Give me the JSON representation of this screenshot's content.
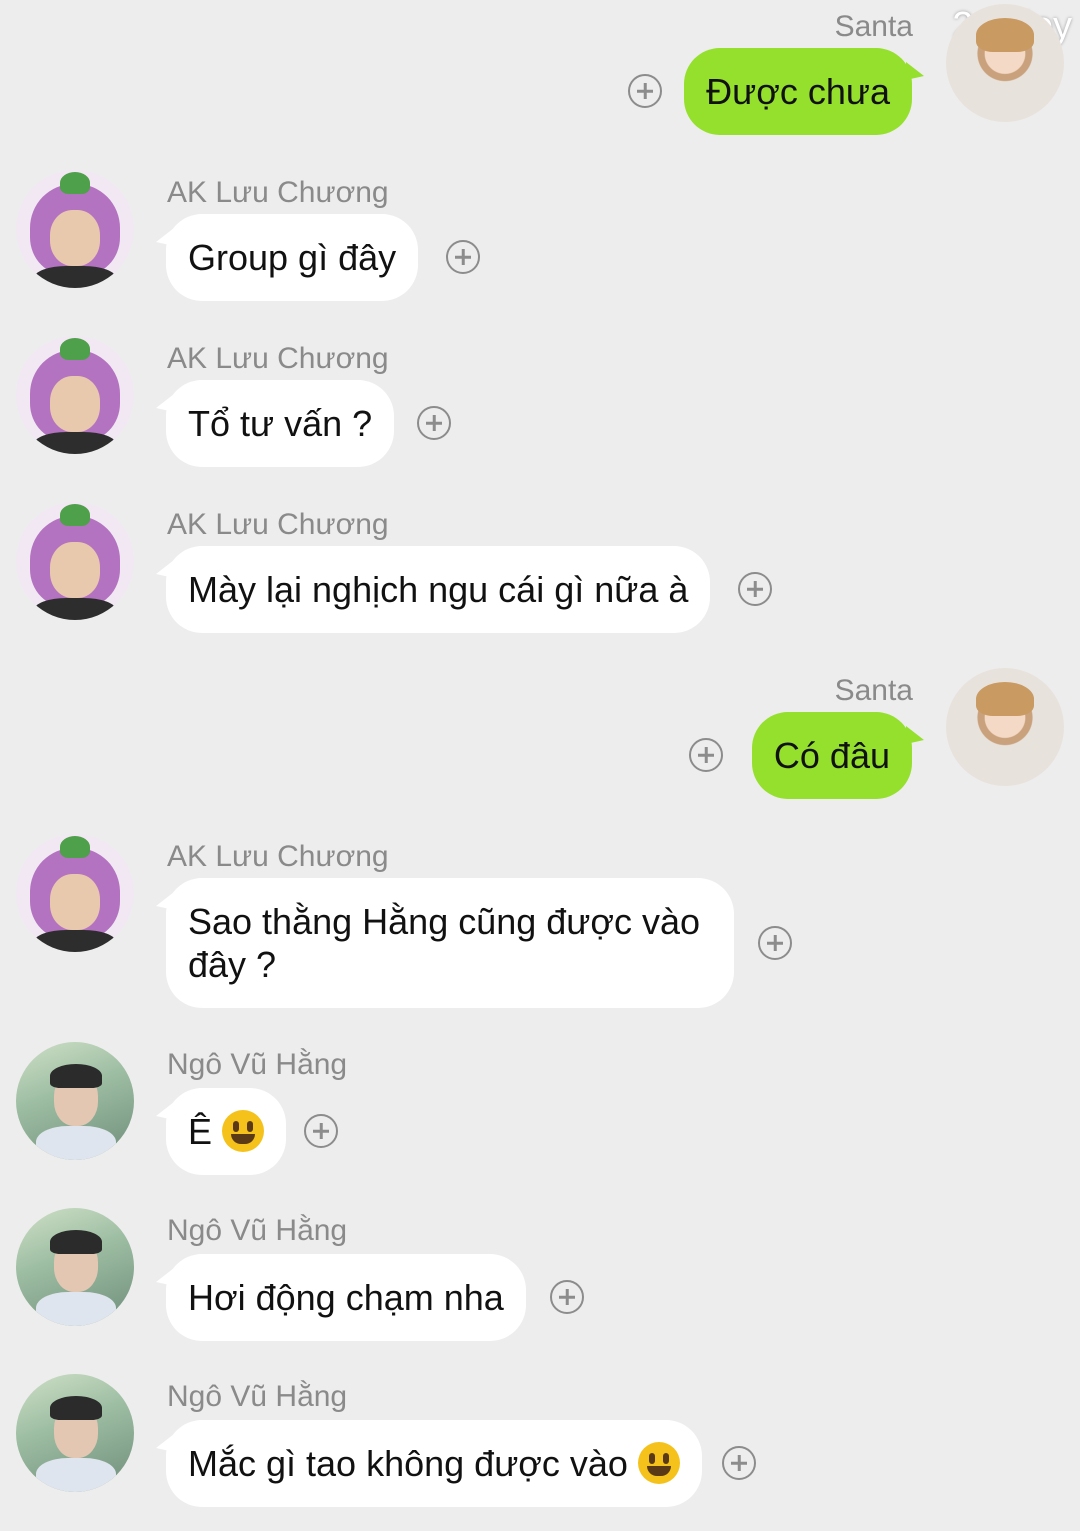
{
  "watermark": "211 joy",
  "messages": [
    {
      "sender": "Santa",
      "text": "Được chưa",
      "side": "out"
    },
    {
      "sender": "AK Lưu Chương",
      "text": "Group gì đây",
      "side": "in"
    },
    {
      "sender": "AK Lưu Chương",
      "text": "Tổ tư vấn ?",
      "side": "in"
    },
    {
      "sender": "AK Lưu Chương",
      "text": "Mày lại nghịch ngu cái gì nữa à",
      "side": "in"
    },
    {
      "sender": "Santa",
      "text": "Có đâu",
      "side": "out"
    },
    {
      "sender": "AK Lưu Chương",
      "text_line1": "Sao thằng Hằng cũng được vào",
      "text_line2": "đây ?",
      "side": "in"
    },
    {
      "sender": "Ngô Vũ Hằng",
      "text": "Ê",
      "emoji": "grinning-face-emoji",
      "side": "in"
    },
    {
      "sender": "Ngô Vũ Hằng",
      "text": "Hơi động chạm nha",
      "side": "in"
    },
    {
      "sender": "Ngô Vũ Hằng",
      "text": "Mắc gì tao không được vào",
      "emoji": "grinning-face-emoji",
      "side": "in"
    }
  ],
  "colors": {
    "background": "#ededed",
    "outgoing_bubble": "#94e02c",
    "incoming_bubble": "#ffffff",
    "sender_name": "#8a8a8a"
  }
}
